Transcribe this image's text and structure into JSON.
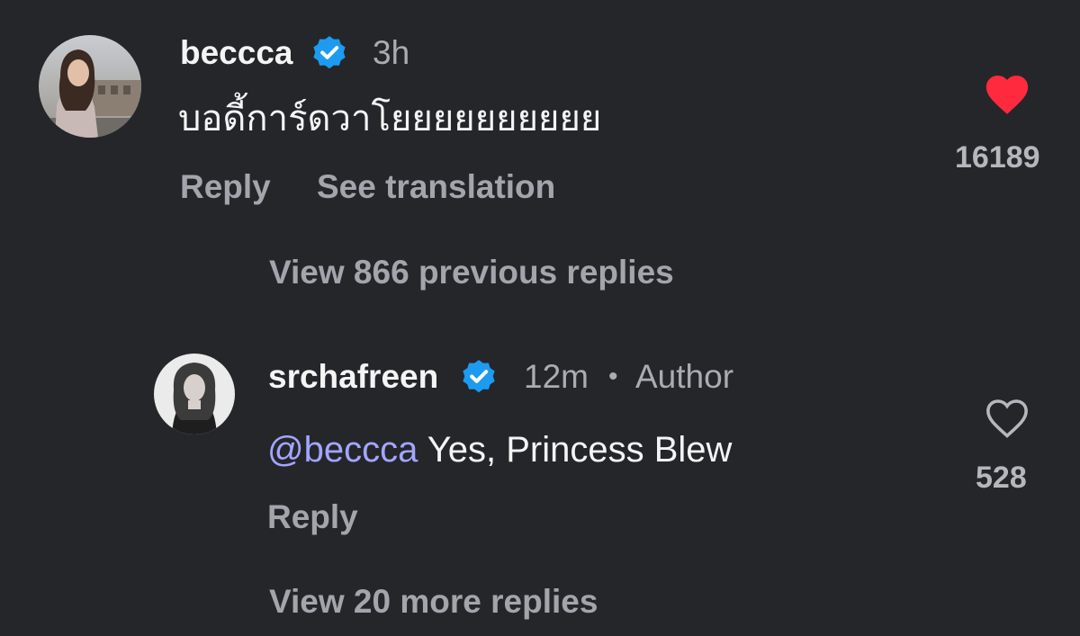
{
  "comment": {
    "username": "beccca",
    "time": "3h",
    "text": "บอดี้การ์ดวาโยยยยยยยยยย",
    "like_count": "16189",
    "liked": true,
    "actions": {
      "reply": "Reply",
      "see_translation": "See translation"
    },
    "view_previous_replies": "View 866 previous replies"
  },
  "reply": {
    "username": "srchafreen",
    "time": "12m",
    "separator": "•",
    "author_badge": "Author",
    "mention": "@beccca",
    "text": " Yes, Princess Blew",
    "like_count": "528",
    "liked": false,
    "actions": {
      "reply": "Reply"
    },
    "view_more_replies": "View 20 more replies"
  },
  "colors": {
    "background": "#25262a",
    "verified_badge": "#1d9bf0",
    "heart_liked": "#ff2a3d",
    "mention": "#a3a6ff",
    "muted_text": "#a9acb3"
  },
  "icons": {
    "verified": "verified-badge-icon",
    "like_filled": "heart-filled-icon",
    "like_outline": "heart-outline-icon"
  }
}
